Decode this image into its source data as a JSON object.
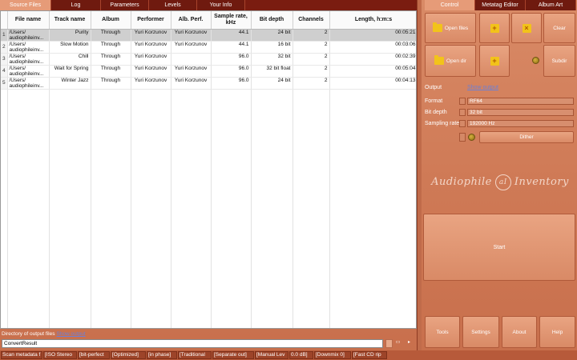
{
  "left_tabs": [
    "Source Files",
    "Log",
    "Parameters",
    "Levels",
    "Your Info"
  ],
  "right_tabs": [
    "Control",
    "Metatag Editor",
    "Album Art"
  ],
  "table": {
    "columns": [
      "File name",
      "Track name",
      "Album",
      "Performer",
      "Alb. Perf.",
      "Sample rate, kHz",
      "Bit depth",
      "Channels",
      "Length, h:m:s"
    ],
    "rows": [
      {
        "idx": "1",
        "file": "/Users/ audiophileinv...",
        "track": "Purity",
        "album": "Through",
        "performer": "Yuri Korzunov",
        "alb_perf": "Yuri Korzunov",
        "rate": "44.1",
        "depth": "24 bit",
        "channels": "2",
        "length": "00:05:21"
      },
      {
        "idx": "2",
        "file": "/Users/ audiophileinv...",
        "track": "Slow Motion",
        "album": "Through",
        "performer": "Yuri Korzunov",
        "alb_perf": "Yuri Korzunov",
        "rate": "44.1",
        "depth": "16 bit",
        "channels": "2",
        "length": "00:03:06"
      },
      {
        "idx": "3",
        "file": "/Users/ audiophileinv...",
        "track": "Chill",
        "album": "Through",
        "performer": "Yuri Korzunov",
        "alb_perf": "",
        "rate": "96.0",
        "depth": "32 bit",
        "channels": "2",
        "length": "00:02:39"
      },
      {
        "idx": "4",
        "file": "/Users/ audiophileinv...",
        "track": "Wait for Spring",
        "album": "Through",
        "performer": "Yuri Korzunov",
        "alb_perf": "Yuri Korzunov",
        "rate": "96.0",
        "depth": "32 bit float",
        "channels": "2",
        "length": "00:05:04"
      },
      {
        "idx": "5",
        "file": "/Users/ audiophileinv...",
        "track": "Winter Jazz",
        "album": "Through",
        "performer": "Yuri Korzunov",
        "alb_perf": "Yuri Korzunov",
        "rate": "96.0",
        "depth": "24 bit",
        "channels": "2",
        "length": "00:04:13"
      }
    ]
  },
  "output": {
    "label": "Directory of output files",
    "link": "Show output",
    "value": "ConvertResult"
  },
  "control": {
    "open_files": "Open files",
    "open_dir": "Open dir",
    "clear": "Clear",
    "subdir": "Subdir",
    "output_label": "Output",
    "output_link": "Show output",
    "format_label": "Format",
    "format_value": "RF64",
    "bit_depth_label": "Bit depth",
    "bit_depth_value": "32 bit",
    "sampling_label": "Sampling rate",
    "sampling_value": "192000 Hz",
    "dither": "Dither",
    "logo_left": "Audiophile",
    "logo_mark": "aI",
    "logo_right": "Inventory",
    "start": "Start",
    "tools": "Tools",
    "settings": "Settings",
    "about": "About",
    "help": "Help"
  },
  "status": [
    "Scan metadata f",
    "[ISO Stereo",
    "[bit-perfect",
    "[Optimized]",
    "[in phase]",
    "[Traditional",
    "[Separate out]",
    "[Manual Lev",
    "0.0 dB]",
    "[Downmix 0]",
    "[Fast CD rip"
  ]
}
